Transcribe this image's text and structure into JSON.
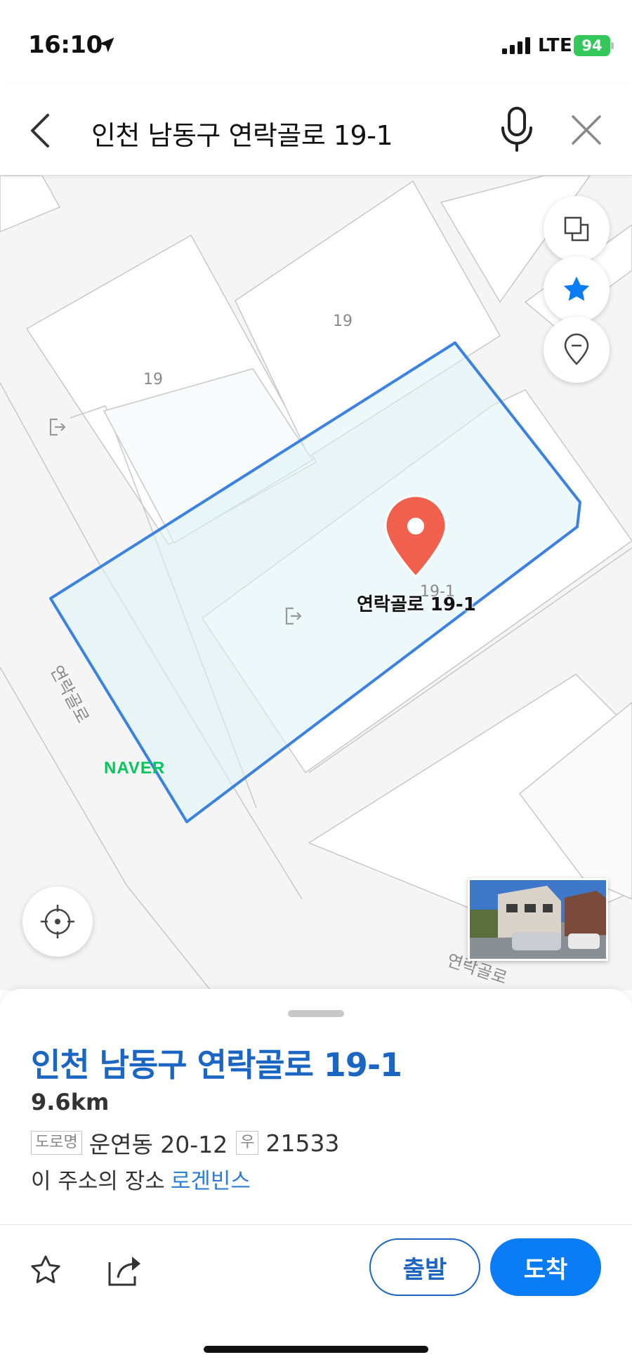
{
  "status_bar": {
    "time": "16:10",
    "network": "LTE",
    "battery": "94",
    "icons": [
      "location-arrow-icon",
      "signal-icon",
      "battery-icon"
    ]
  },
  "search": {
    "query": "인천 남동구 연락골로 19-1",
    "icons": [
      "chevron-left-icon",
      "microphone-icon",
      "close-icon"
    ]
  },
  "map": {
    "lot_labels": [
      "19",
      "19",
      "19-1"
    ],
    "marker_label": "연락골로 19-1",
    "road_labels": [
      "연락골로",
      "연락골로"
    ],
    "logo": "NAVER",
    "buttons": [
      "layers-icon",
      "star-icon",
      "pin-icon",
      "current-location-icon"
    ],
    "highlight_color": "#3b82e0",
    "marker_color": "#f0604d"
  },
  "place": {
    "title": "인천 남동구 연락골로 19-1",
    "distance": "9.6km",
    "road_tag": "도로명",
    "road_address": "운연동 20-12",
    "postal_tag": "우",
    "postal_code": "21533",
    "place_prefix": "이 주소의 장소",
    "place_link": "로겐빈스"
  },
  "actions": {
    "depart": "출발",
    "arrive": "도착"
  }
}
